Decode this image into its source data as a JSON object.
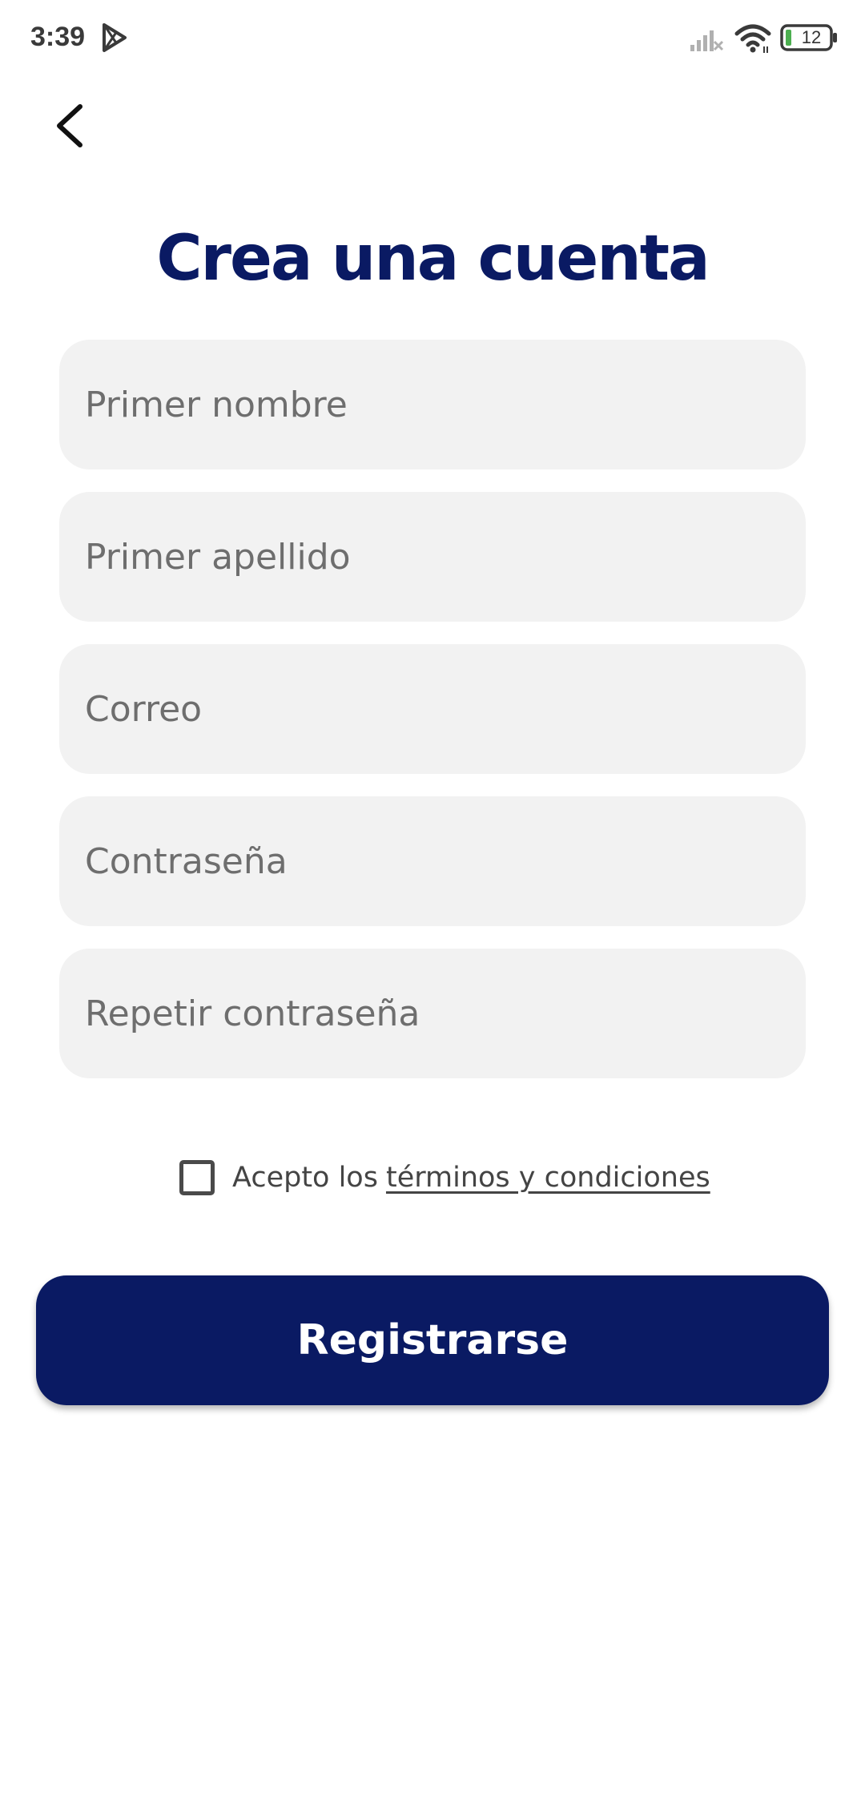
{
  "status_bar": {
    "time": "3:39",
    "battery_level": "12",
    "icons": [
      "play-store-icon",
      "signal-icon",
      "wifi-icon",
      "battery-icon"
    ]
  },
  "header": {
    "back_icon": "chevron-left-icon"
  },
  "title": "Crea una cuenta",
  "form": {
    "first_name": {
      "placeholder": "Primer nombre",
      "value": ""
    },
    "last_name": {
      "placeholder": "Primer apellido",
      "value": ""
    },
    "email": {
      "placeholder": "Correo",
      "value": ""
    },
    "password": {
      "placeholder": "Contraseña",
      "value": ""
    },
    "repeat_password": {
      "placeholder": "Repetir contraseña",
      "value": ""
    }
  },
  "terms": {
    "checked": false,
    "prefix": "Acepto los",
    "link": "términos y condiciones"
  },
  "register_button": {
    "label": "Registrarse"
  },
  "colors": {
    "primary": "#0a1a63",
    "field_background": "#f2f2f2",
    "placeholder_text": "#6e6e6e",
    "background": "#ffffff"
  }
}
